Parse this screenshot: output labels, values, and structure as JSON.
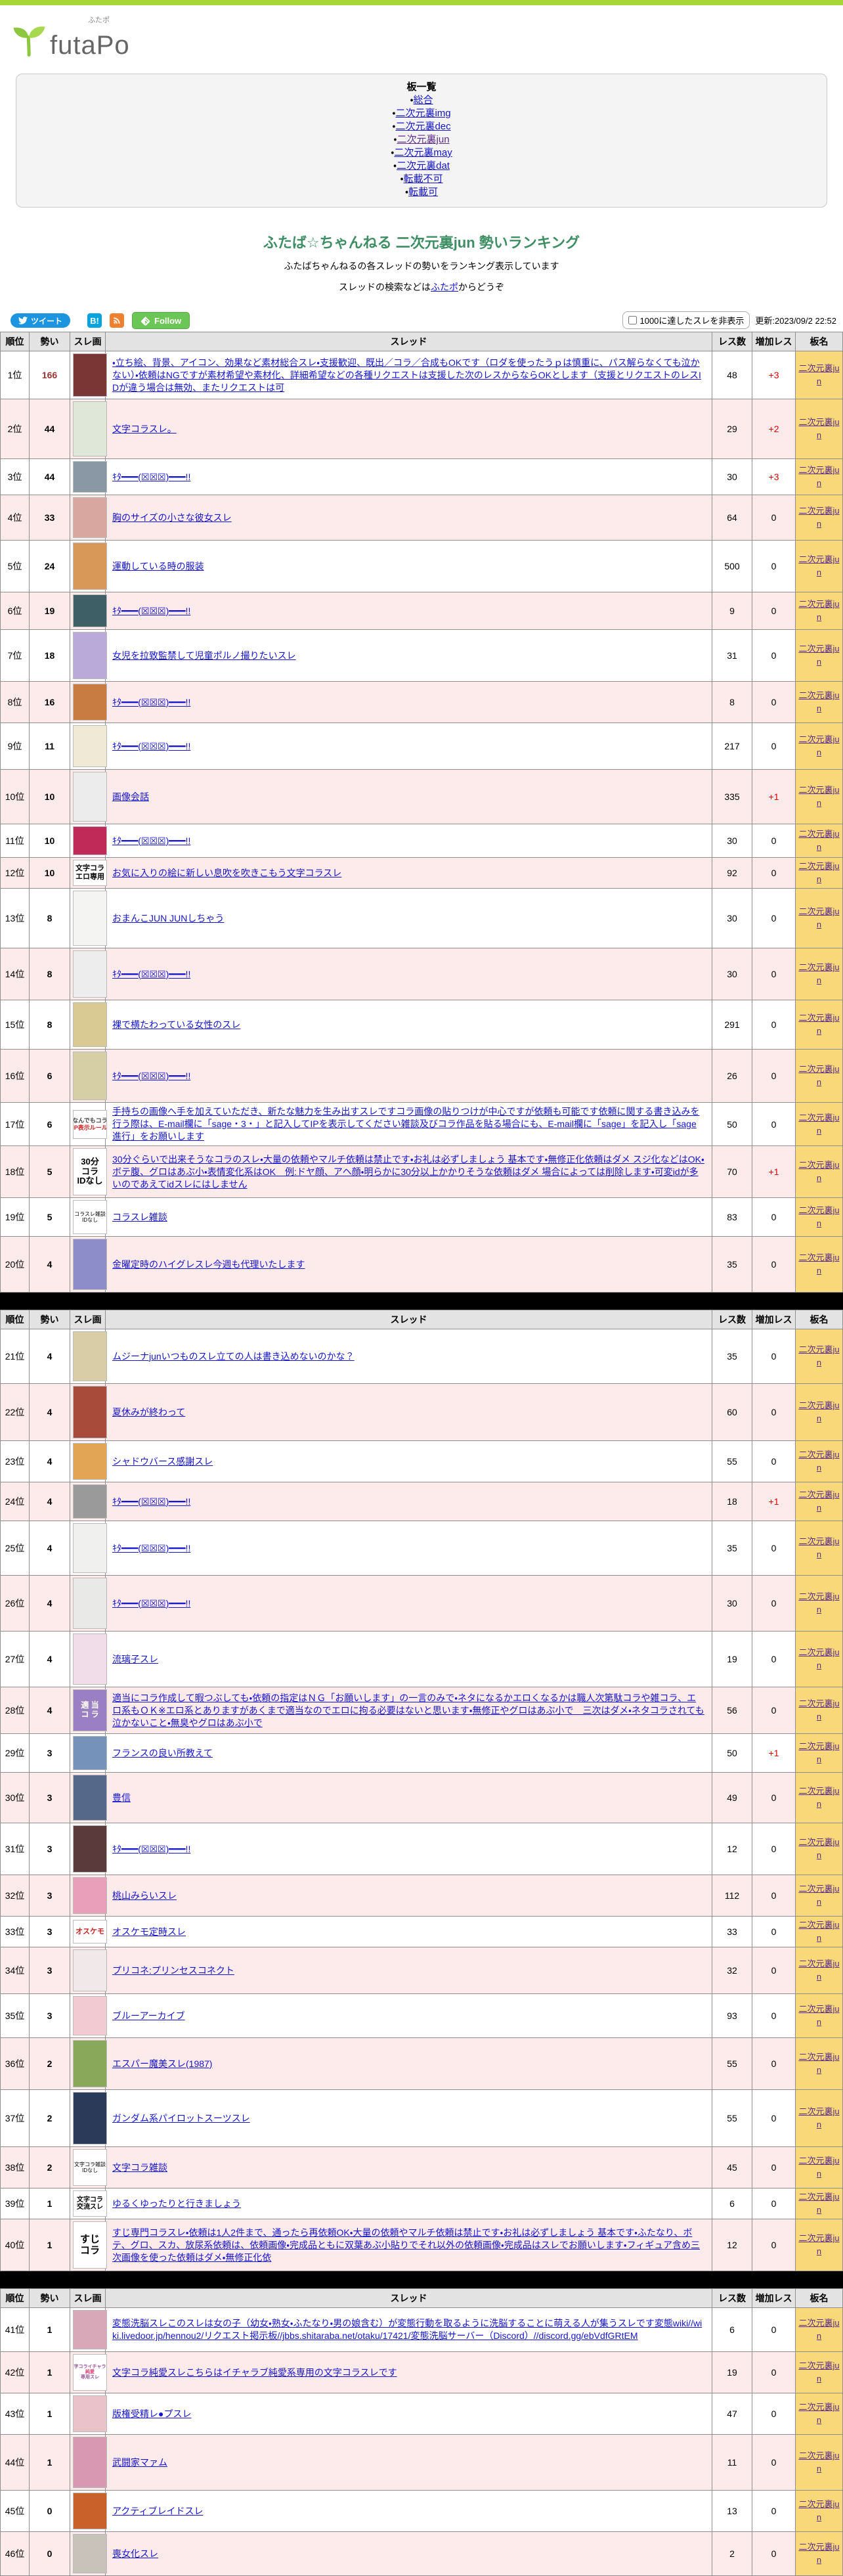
{
  "header": {
    "logo_text": "futaPo",
    "logo_ruby": "ふたポ"
  },
  "board_list": {
    "title": "板一覧",
    "bullet": "・",
    "items": [
      {
        "label": "総合",
        "visited": false
      },
      {
        "label": "二次元裏img",
        "visited": false
      },
      {
        "label": "二次元裏dec",
        "visited": false
      },
      {
        "label": "二次元裏jun",
        "visited": true
      },
      {
        "label": "二次元裏may",
        "visited": false
      },
      {
        "label": "二次元裏dat",
        "visited": false
      },
      {
        "label": "転載不可",
        "visited": false
      },
      {
        "label": "転載可",
        "visited": false
      }
    ]
  },
  "page": {
    "title": "ふたば☆ちゃんねる 二次元裏jun 勢いランキング",
    "subtitle1": "ふたばちゃんねるの各スレッドの勢いをランキング表示しています",
    "subtitle2_pre": "スレッドの検索などは",
    "subtitle2_link": "ふたポ",
    "subtitle2_post": "からどうぞ"
  },
  "toolbar": {
    "tweet_label": "ツイート",
    "hatena_label": "B!",
    "follow_label": "Follow",
    "hide_checkbox_label": "1000に達したスレを非表示",
    "updated_label": "更新:2023/09/2 22:52"
  },
  "table": {
    "columns": [
      "順位",
      "勢い",
      "スレ画",
      "スレッド",
      "レス数",
      "増加レス",
      "板名"
    ],
    "board_label": "二次元裏jun",
    "sections": [
      {
        "start": 0,
        "count": 20
      },
      {
        "start": 20,
        "count": 20
      },
      {
        "start": 40,
        "count": 6
      }
    ]
  },
  "colors": {
    "accent_green": "#3e8e63",
    "topbar_green": "#a8d636",
    "board_cell_bg": "#f8d878",
    "row_pink": "#fdeaea",
    "delta_red": "#e00000",
    "link_blue": "#1515cc",
    "link_visited_purple": "#5b2d8a"
  },
  "rankings": [
    {
      "rank": "1位",
      "momentum": "166",
      "momentum_color": "#993333",
      "title": "・立ち絵、背景、アイコン、効果など素材総合スレ・支援歓迎、既出／コラ／合成もOKです（ロダを使ったうｐは慎重に、パス解らなくても泣かない）・依頼はNGですが素材希望や素材化、詳細希望などの各種リクエストは支援した次のレスからならOKとします（支援とリクエストのレスIDが違う場合は無効、またリクエストは可",
      "res": "48",
      "delta": "+3",
      "thumb": {
        "color": "#7a3535",
        "h": 66
      }
    },
    {
      "rank": "2位",
      "momentum": "44",
      "title": "文字コラスレ。",
      "res": "29",
      "delta": "+2",
      "thumb": {
        "color": "#dfe8d8",
        "h": 84
      }
    },
    {
      "rank": "3位",
      "momentum": "44",
      "title": "ｷﾀ━━━(☒☒☒)━━━!!",
      "res": "30",
      "delta": "+3",
      "thumb": {
        "color": "#8a98a6",
        "h": 48
      }
    },
    {
      "rank": "4位",
      "momentum": "33",
      "title": "胸のサイズの小さな彼女スレ",
      "res": "64",
      "delta": "0",
      "thumb": {
        "color": "#d8a8a0",
        "h": 62
      }
    },
    {
      "rank": "5位",
      "momentum": "24",
      "title": "運動している時の服装",
      "res": "500",
      "delta": "0",
      "thumb": {
        "color": "#d89858",
        "h": 72
      }
    },
    {
      "rank": "6位",
      "momentum": "19",
      "title": "ｷﾀ━━━(☒☒☒)━━━!!",
      "res": "9",
      "delta": "0",
      "thumb": {
        "color": "#3f5f66",
        "h": 50
      }
    },
    {
      "rank": "7位",
      "momentum": "18",
      "title": "女児を拉致監禁して児童ポルノ撮りたいスレ",
      "res": "31",
      "delta": "0",
      "thumb": {
        "color": "#b9aad9",
        "h": 72
      }
    },
    {
      "rank": "8位",
      "momentum": "16",
      "title": "ｷﾀ━━━(☒☒☒)━━━!!",
      "res": "8",
      "delta": "0",
      "thumb": {
        "color": "#c87c42",
        "h": 56
      }
    },
    {
      "rank": "9位",
      "momentum": "11",
      "title": "ｷﾀ━━━(☒☒☒)━━━!!",
      "res": "217",
      "delta": "0",
      "thumb": {
        "color": "#efe9d6",
        "h": 64
      }
    },
    {
      "rank": "10位",
      "momentum": "10",
      "title": "画像会話",
      "res": "335",
      "delta": "+1",
      "thumb": {
        "color": "#ececec",
        "h": 76
      }
    },
    {
      "rank": "11位",
      "momentum": "10",
      "title": "ｷﾀ━━━(☒☒☒)━━━!!",
      "res": "30",
      "delta": "0",
      "thumb": {
        "color": "#c02a58",
        "h": 44
      }
    },
    {
      "rank": "12位",
      "momentum": "10",
      "title": "お気に入りの絵に新しい息吹を吹きこもう文字コラスレ",
      "res": "92",
      "delta": "0",
      "thumb": {
        "text": [
          "文字コラ",
          "エロ専用"
        ],
        "fs": 11,
        "h": 40
      }
    },
    {
      "rank": "13位",
      "momentum": "8",
      "title": "おまんこJUN JUNしちゃう",
      "res": "30",
      "delta": "0",
      "thumb": {
        "color": "#f4f4f2",
        "h": 84
      }
    },
    {
      "rank": "14位",
      "momentum": "8",
      "title": "ｷﾀ━━━(☒☒☒)━━━!!",
      "res": "30",
      "delta": "0",
      "thumb": {
        "color": "#ededed",
        "h": 72
      }
    },
    {
      "rank": "15位",
      "momentum": "8",
      "title": "裸で横たわっている女性のスレ",
      "res": "291",
      "delta": "0",
      "thumb": {
        "color": "#d9c992",
        "h": 68
      }
    },
    {
      "rank": "16位",
      "momentum": "6",
      "title": "ｷﾀ━━━(☒☒☒)━━━!!",
      "res": "26",
      "delta": "0",
      "thumb": {
        "color": "#d6cfa6",
        "h": 74
      }
    },
    {
      "rank": "17位",
      "momentum": "6",
      "title": "手持ちの画像へ手を加えていただき、新たな魅力を生み出すスレですコラ画像の貼りつけが中心ですが依頼も可能です依頼に関する書き込みを行う際は、E-mail欄に「sage・3・」と記入してIPを表示してください雑談及びコラ作品を貼る場合にも、E-mail欄に「sage」を記入し「sage進行」をお願いします",
      "res": "50",
      "delta": "0",
      "thumb": {
        "text": [
          "なんでもコラ",
          "IP表示ルール"
        ],
        "line_colors": [
          "#444444",
          "#cc2222"
        ],
        "fs": 9,
        "h": 44
      }
    },
    {
      "rank": "18位",
      "momentum": "5",
      "title": "30分ぐらいで出来そうなコラのスレ・大量の依頼やマルチ依頼は禁止です・お礼は必ずしましょう 基本です・無修正化依頼はダメ スジ化などはOK・ボテ腹、グロはあぶ小・表情変化系はOK　例:ドヤ顔、アヘ顔・明らかに30分以上かかりそうな依頼はダメ 場合によっては削除します・可変idが多いのであえてidスレにはしません",
      "res": "70",
      "delta": "+1",
      "thumb": {
        "text": [
          "30分",
          "コラ",
          "IDなし"
        ],
        "fs": 13,
        "h": 72
      }
    },
    {
      "rank": "19位",
      "momentum": "5",
      "title": "コラスレ雑談",
      "res": "83",
      "delta": "0",
      "thumb": {
        "text": [
          "コラスレ雑談",
          "IDなし"
        ],
        "fs": 8,
        "h": 52,
        "plain": true
      }
    },
    {
      "rank": "20位",
      "momentum": "4",
      "title": "金曜定時のハイグレスレ今週も代理いたします",
      "res": "35",
      "delta": "0",
      "thumb": {
        "color": "#8d8dc9",
        "h": 78
      }
    },
    {
      "rank": "21位",
      "momentum": "4",
      "title": "ムジーナjunいつものスレ立ての人は書き込めないのかな？",
      "res": "35",
      "delta": "0",
      "thumb": {
        "color": "#d9cda8",
        "h": 76
      }
    },
    {
      "rank": "22位",
      "momentum": "4",
      "title": "夏休みが終わって",
      "res": "60",
      "delta": "0",
      "thumb": {
        "color": "#a84b3a",
        "h": 80
      }
    },
    {
      "rank": "23位",
      "momentum": "4",
      "title": "シャドウバース感謝スレ",
      "res": "55",
      "delta": "0",
      "thumb": {
        "color": "#e2a455",
        "h": 56
      }
    },
    {
      "rank": "24位",
      "momentum": "4",
      "title": "ｷﾀ━━━(☒☒☒)━━━!!",
      "res": "18",
      "delta": "+1",
      "thumb": {
        "color": "#9a9a9a",
        "h": 52
      }
    },
    {
      "rank": "25位",
      "momentum": "4",
      "title": "ｷﾀ━━━(☒☒☒)━━━!!",
      "res": "35",
      "delta": "0",
      "thumb": {
        "color": "#f0f0ee",
        "h": 76
      }
    },
    {
      "rank": "26位",
      "momentum": "4",
      "title": "ｷﾀ━━━(☒☒☒)━━━!!",
      "res": "30",
      "delta": "0",
      "thumb": {
        "color": "#e9e9e7",
        "h": 78
      }
    },
    {
      "rank": "27位",
      "momentum": "4",
      "title": "流璃子スレ",
      "res": "19",
      "delta": "0",
      "thumb": {
        "color": "#f1dde9",
        "h": 78
      }
    },
    {
      "rank": "28位",
      "momentum": "4",
      "title": "適当にコラ作成して暇つぶしても・依頼の指定はＮＧ「お願いします」の一言のみで・ネタになるかエロくなるかは職人次第駄コラや雑コラ、エロ系もＯＫ※エロ系とありますがあくまで適当なのでエロに拘る必要はないと思います・無修正やグロはあぶ小で　三次はダメ・ネタコラされても泣かないこと・無臭やグロはあぶ小で",
      "res": "56",
      "delta": "0",
      "thumb": {
        "text": [
          "適 当",
          "コ ラ"
        ],
        "bg": "#9b7fc4",
        "line_colors": [
          "#ffffee",
          "#ffffee"
        ],
        "fs": 12,
        "h": 64
      }
    },
    {
      "rank": "29位",
      "momentum": "3",
      "title": "フランスの良い所教えて",
      "res": "50",
      "delta": "+1",
      "thumb": {
        "color": "#7492ba",
        "h": 52
      }
    },
    {
      "rank": "30位",
      "momentum": "3",
      "title": "豊信",
      "res": "49",
      "delta": "0",
      "thumb": {
        "color": "#56688a",
        "h": 70
      }
    },
    {
      "rank": "31位",
      "momentum": "3",
      "title": "ｷﾀ━━━(☒☒☒)━━━!!",
      "res": "12",
      "delta": "0",
      "thumb": {
        "color": "#5a3a3a",
        "h": 72
      }
    },
    {
      "rank": "32位",
      "momentum": "3",
      "title": "桃山みらいスレ",
      "res": "112",
      "delta": "0",
      "thumb": {
        "color": "#e99fba",
        "h": 56
      }
    },
    {
      "rank": "33位",
      "momentum": "3",
      "title": "オスケモ定時スレ",
      "res": "33",
      "delta": "0",
      "thumb": {
        "text": [
          "オスケモ"
        ],
        "line_colors": [
          "#cc2222"
        ],
        "fs": 11,
        "h": 36
      }
    },
    {
      "rank": "34位",
      "momentum": "3",
      "title": "プリコネ:プリンセスコネクト",
      "res": "32",
      "delta": "0",
      "thumb": {
        "color": "#f1e9e9",
        "h": 64
      }
    },
    {
      "rank": "35位",
      "momentum": "3",
      "title": "ブルーアーカイブ",
      "res": "93",
      "delta": "0",
      "thumb": {
        "color": "#f2cad2",
        "h": 60
      }
    },
    {
      "rank": "36位",
      "momentum": "2",
      "title": "エスパー魔美スレ(1987)",
      "res": "55",
      "delta": "0",
      "thumb": {
        "color": "#8aa85a",
        "h": 72
      }
    },
    {
      "rank": "37位",
      "momentum": "2",
      "title": "ガンダム系パイロットスーツスレ",
      "res": "55",
      "delta": "0",
      "thumb": {
        "color": "#2c3a5a",
        "h": 80
      }
    },
    {
      "rank": "38位",
      "momentum": "2",
      "title": "文字コラ雑談",
      "res": "45",
      "delta": "0",
      "thumb": {
        "text": [
          "文字コラ雑談",
          "IDなし"
        ],
        "fs": 8,
        "h": 56,
        "plain": true
      }
    },
    {
      "rank": "39位",
      "momentum": "1",
      "title": "ゆるくゆったりと行きましょう",
      "res": "6",
      "delta": "0",
      "thumb": {
        "text": [
          "文字コラ",
          "交流スレ"
        ],
        "fs": 10,
        "h": 40
      }
    },
    {
      "rank": "40位",
      "momentum": "1",
      "title": "すじ専門コラスレ・依頼は1人2件まで、通ったら再依頼OK・大量の依頼やマルチ依頼は禁止です・お礼は必ずしましょう 基本です・ふたなり、ボテ、グロ、スカ、放尿系依頼は、依頼画像・完成品ともに双葉あぶ小貼りでそれ以外の依頼画像・完成品はスレでお願いします・フィギュア含め三次画像を使った依頼はダメ・無修正化依",
      "res": "12",
      "delta": "0",
      "thumb": {
        "text": [
          "すじ",
          "コラ"
        ],
        "fs": 15,
        "h": 72
      }
    },
    {
      "rank": "41位",
      "momentum": "1",
      "title": "変態洗脳スレこのスレは女の子（幼女・熟女・ふたなり・男の娘含む）が変態行動を取るように洗脳することに萌える人が集うスレです変態wiki//wiki.livedoor.jp/hennou2/リクエスト掲示板//jbbs.shitaraba.net/otaku/17421/変態洗脳サーバー（Discord）//discord.gg/ebVdfGRtEM",
      "res": "6",
      "delta": "0",
      "thumb": {
        "color": "#d8a8b8",
        "h": 60
      }
    },
    {
      "rank": "42位",
      "momentum": "1",
      "title": "文字コラ純愛スレこちらはイチャラブ純愛系専用の文字コラスレです",
      "res": "19",
      "delta": "0",
      "thumb": {
        "text": [
          "文字コライチャラブ",
          "純愛",
          "専用スレ"
        ],
        "line_colors": [
          "#995599",
          "#dd4477",
          "#995599"
        ],
        "fs": 7,
        "h": 56
      }
    },
    {
      "rank": "43位",
      "momentum": "1",
      "title": "版権受精レ●プスレ",
      "res": "47",
      "delta": "0",
      "thumb": {
        "color": "#e9c2ca",
        "h": 56
      }
    },
    {
      "rank": "44位",
      "momentum": "1",
      "title": "武闘家マァム",
      "res": "11",
      "delta": "0",
      "thumb": {
        "color": "#d898b2",
        "h": 78
      }
    },
    {
      "rank": "45位",
      "momentum": "0",
      "title": "アクティブレイドスレ",
      "res": "13",
      "delta": "0",
      "thumb": {
        "color": "#c8622a",
        "h": 56
      }
    },
    {
      "rank": "46位",
      "momentum": "0",
      "title": "喪女化スレ",
      "res": "2",
      "delta": "0",
      "thumb": {
        "color": "#c9c2ba",
        "h": 60
      }
    }
  ]
}
